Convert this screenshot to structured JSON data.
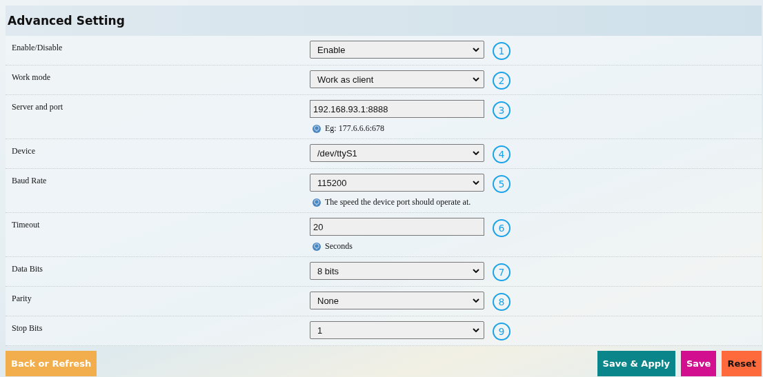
{
  "title": "Advanced Setting",
  "rows": [
    {
      "label": "Enable/Disable",
      "kind": "select",
      "value": "Enable",
      "marker": "1"
    },
    {
      "label": "Work mode",
      "kind": "select",
      "value": "Work as client",
      "marker": "2"
    },
    {
      "label": "Server and port",
      "kind": "text",
      "value": "192.168.93.1:8888",
      "hint": "Eg: 177.6.6.6:678",
      "marker": "3"
    },
    {
      "label": "Device",
      "kind": "select",
      "value": "/dev/ttyS1",
      "marker": "4"
    },
    {
      "label": "Baud Rate",
      "kind": "select",
      "value": "115200",
      "hint": "The speed the device port should operate at.",
      "marker": "5"
    },
    {
      "label": "Timeout",
      "kind": "text",
      "value": "20",
      "hint": "Seconds",
      "marker": "6"
    },
    {
      "label": "Data Bits",
      "kind": "select",
      "value": "8 bits",
      "marker": "7"
    },
    {
      "label": "Parity",
      "kind": "select",
      "value": "None",
      "marker": "8"
    },
    {
      "label": "Stop Bits",
      "kind": "select",
      "value": "1",
      "marker": "9"
    }
  ],
  "buttons": [
    {
      "label": "Back or Refresh",
      "kind": "back"
    },
    {
      "label": "Save & Apply",
      "kind": "apply"
    },
    {
      "label": "Save",
      "kind": "save"
    },
    {
      "label": "Reset",
      "kind": "reset"
    }
  ]
}
